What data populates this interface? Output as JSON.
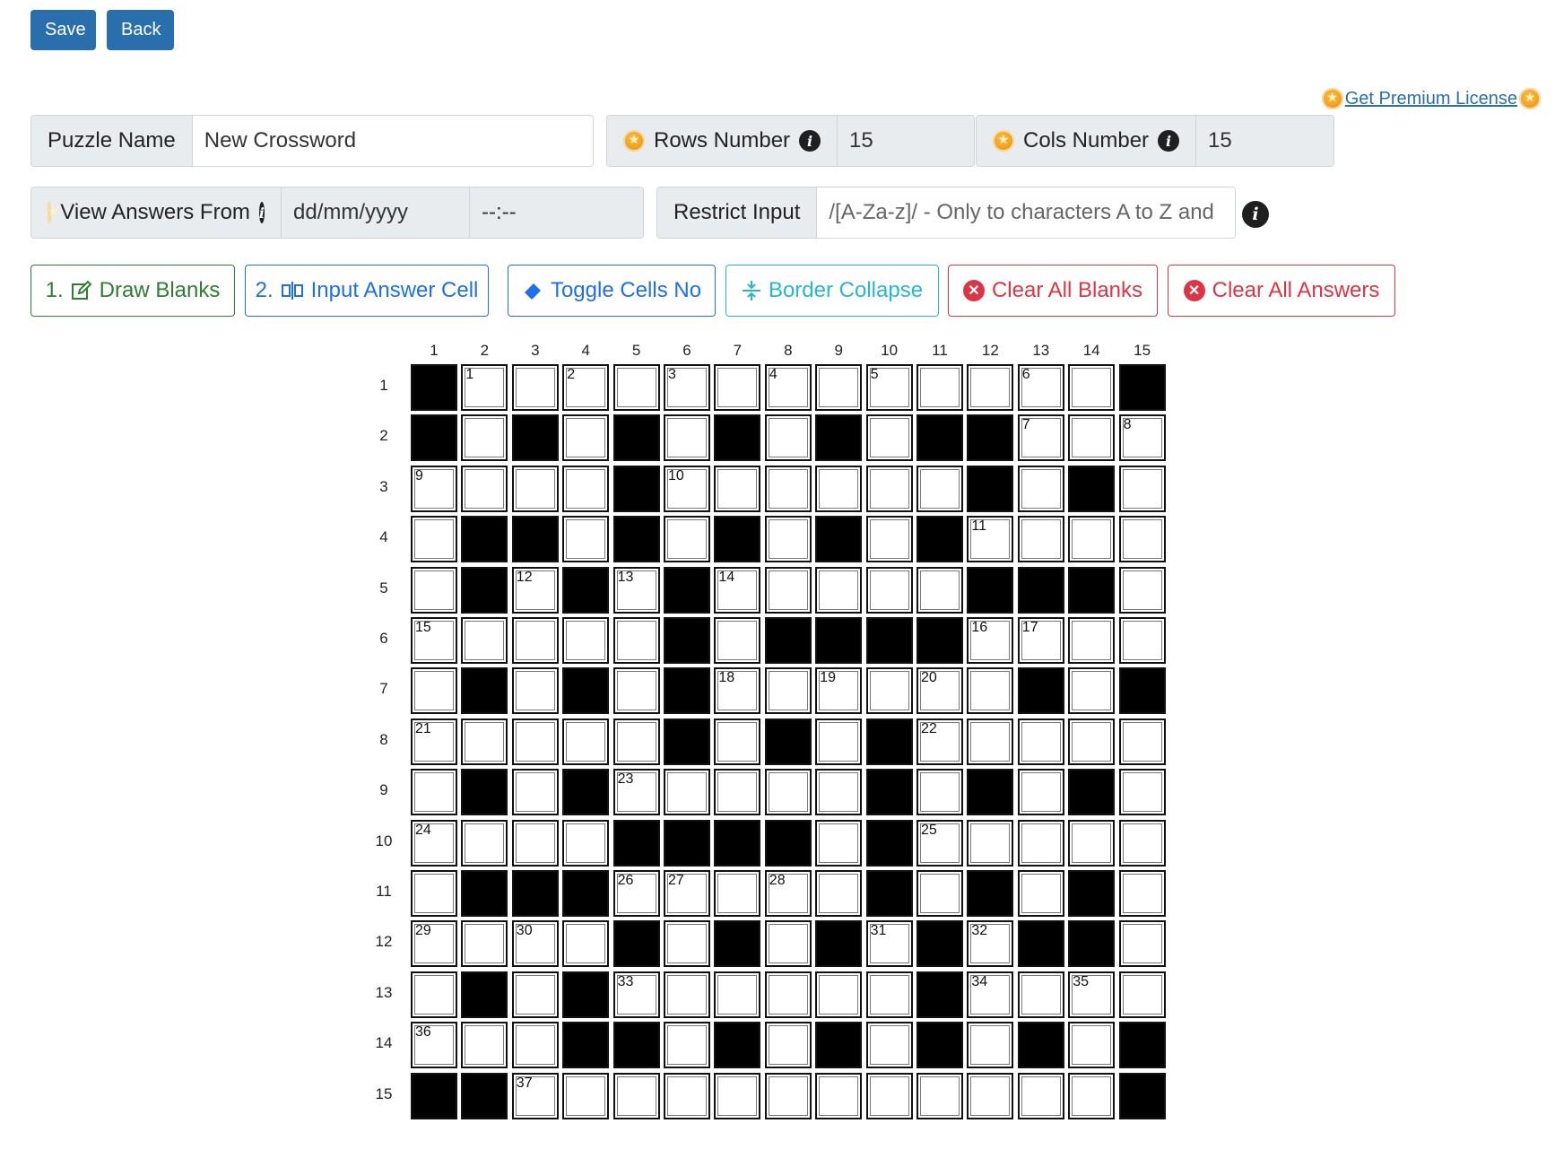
{
  "toolbar": {
    "save_label": "Save",
    "back_label": "Back"
  },
  "premium": {
    "label": "Get Premium License "
  },
  "puzzle_name": {
    "label": "Puzzle Name",
    "value": "New Crossword"
  },
  "rows": {
    "label": "Rows Number",
    "value": "15"
  },
  "cols": {
    "label": "Cols Number",
    "value": "15"
  },
  "view_answers": {
    "label": "View Answers From",
    "date_placeholder": "dd/mm/yyyy",
    "time_placeholder": "--:--"
  },
  "restrict": {
    "label": "Restrict Input",
    "value": "/[A-Za-z]/ - Only to characters A to Z and"
  },
  "tools": {
    "draw_blanks": {
      "prefix": "1.",
      "label": "Draw Blanks"
    },
    "input_answer": {
      "prefix": "2.",
      "label": "Input Answer Cell"
    },
    "toggle_cells": {
      "label": "Toggle Cells No"
    },
    "border_collapse": {
      "label": "Border Collapse"
    },
    "clear_blanks": {
      "label": "Clear All Blanks"
    },
    "clear_answers": {
      "label": "Clear All Answers"
    }
  },
  "colors": {
    "primary": "#2a6fad",
    "green": "#2e7d32",
    "blue": "#1e6fe8",
    "cyan": "#27b6d4",
    "red": "#dc3545"
  },
  "grid": {
    "col_labels": [
      "1",
      "2",
      "3",
      "4",
      "5",
      "6",
      "7",
      "8",
      "9",
      "10",
      "11",
      "12",
      "13",
      "14",
      "15"
    ],
    "row_labels": [
      "1",
      "2",
      "3",
      "4",
      "5",
      "6",
      "7",
      "8",
      "9",
      "10",
      "11",
      "12",
      "13",
      "14",
      "15"
    ],
    "rows": [
      "#.............##",
      "#.#.#.#.#.##...",
      "....#......#.#.",
      ".##.#.#.#.#....",
      ".#.#.#.....###.",
      ".....#.####....",
      ".#.#.#......#.#.",
      ".....#.#.#.....",
      ".#.#.....#.#.#.",
      "....####.#.....",
      ".###.....#.#.#.",
      "....#.#.#.#.##.",
      ".#.#......#....",
      "...##.#.#.#.#.#",
      "##............#"
    ],
    "numbers": [
      {
        "r": 1,
        "c": 2,
        "n": "1"
      },
      {
        "r": 1,
        "c": 4,
        "n": "2"
      },
      {
        "r": 1,
        "c": 6,
        "n": "3"
      },
      {
        "r": 1,
        "c": 8,
        "n": "4"
      },
      {
        "r": 1,
        "c": 10,
        "n": "5"
      },
      {
        "r": 1,
        "c": 13,
        "n": "6"
      },
      {
        "r": 2,
        "c": 13,
        "n": "7"
      },
      {
        "r": 2,
        "c": 15,
        "n": "8"
      },
      {
        "r": 3,
        "c": 1,
        "n": "9"
      },
      {
        "r": 3,
        "c": 6,
        "n": "10"
      },
      {
        "r": 4,
        "c": 12,
        "n": "11"
      },
      {
        "r": 5,
        "c": 3,
        "n": "12"
      },
      {
        "r": 5,
        "c": 5,
        "n": "13"
      },
      {
        "r": 5,
        "c": 7,
        "n": "14"
      },
      {
        "r": 6,
        "c": 1,
        "n": "15"
      },
      {
        "r": 6,
        "c": 12,
        "n": "16"
      },
      {
        "r": 6,
        "c": 13,
        "n": "17"
      },
      {
        "r": 7,
        "c": 7,
        "n": "18"
      },
      {
        "r": 7,
        "c": 9,
        "n": "19"
      },
      {
        "r": 7,
        "c": 11,
        "n": "20"
      },
      {
        "r": 8,
        "c": 1,
        "n": "21"
      },
      {
        "r": 8,
        "c": 11,
        "n": "22"
      },
      {
        "r": 9,
        "c": 5,
        "n": "23"
      },
      {
        "r": 10,
        "c": 1,
        "n": "24"
      },
      {
        "r": 10,
        "c": 11,
        "n": "25"
      },
      {
        "r": 11,
        "c": 5,
        "n": "26"
      },
      {
        "r": 11,
        "c": 6,
        "n": "27"
      },
      {
        "r": 11,
        "c": 8,
        "n": "28"
      },
      {
        "r": 12,
        "c": 1,
        "n": "29"
      },
      {
        "r": 12,
        "c": 3,
        "n": "30"
      },
      {
        "r": 12,
        "c": 10,
        "n": "31"
      },
      {
        "r": 12,
        "c": 12,
        "n": "32"
      },
      {
        "r": 13,
        "c": 5,
        "n": "33"
      },
      {
        "r": 13,
        "c": 12,
        "n": "34"
      },
      {
        "r": 13,
        "c": 14,
        "n": "35"
      },
      {
        "r": 14,
        "c": 1,
        "n": "36"
      },
      {
        "r": 15,
        "c": 3,
        "n": "37"
      }
    ]
  }
}
